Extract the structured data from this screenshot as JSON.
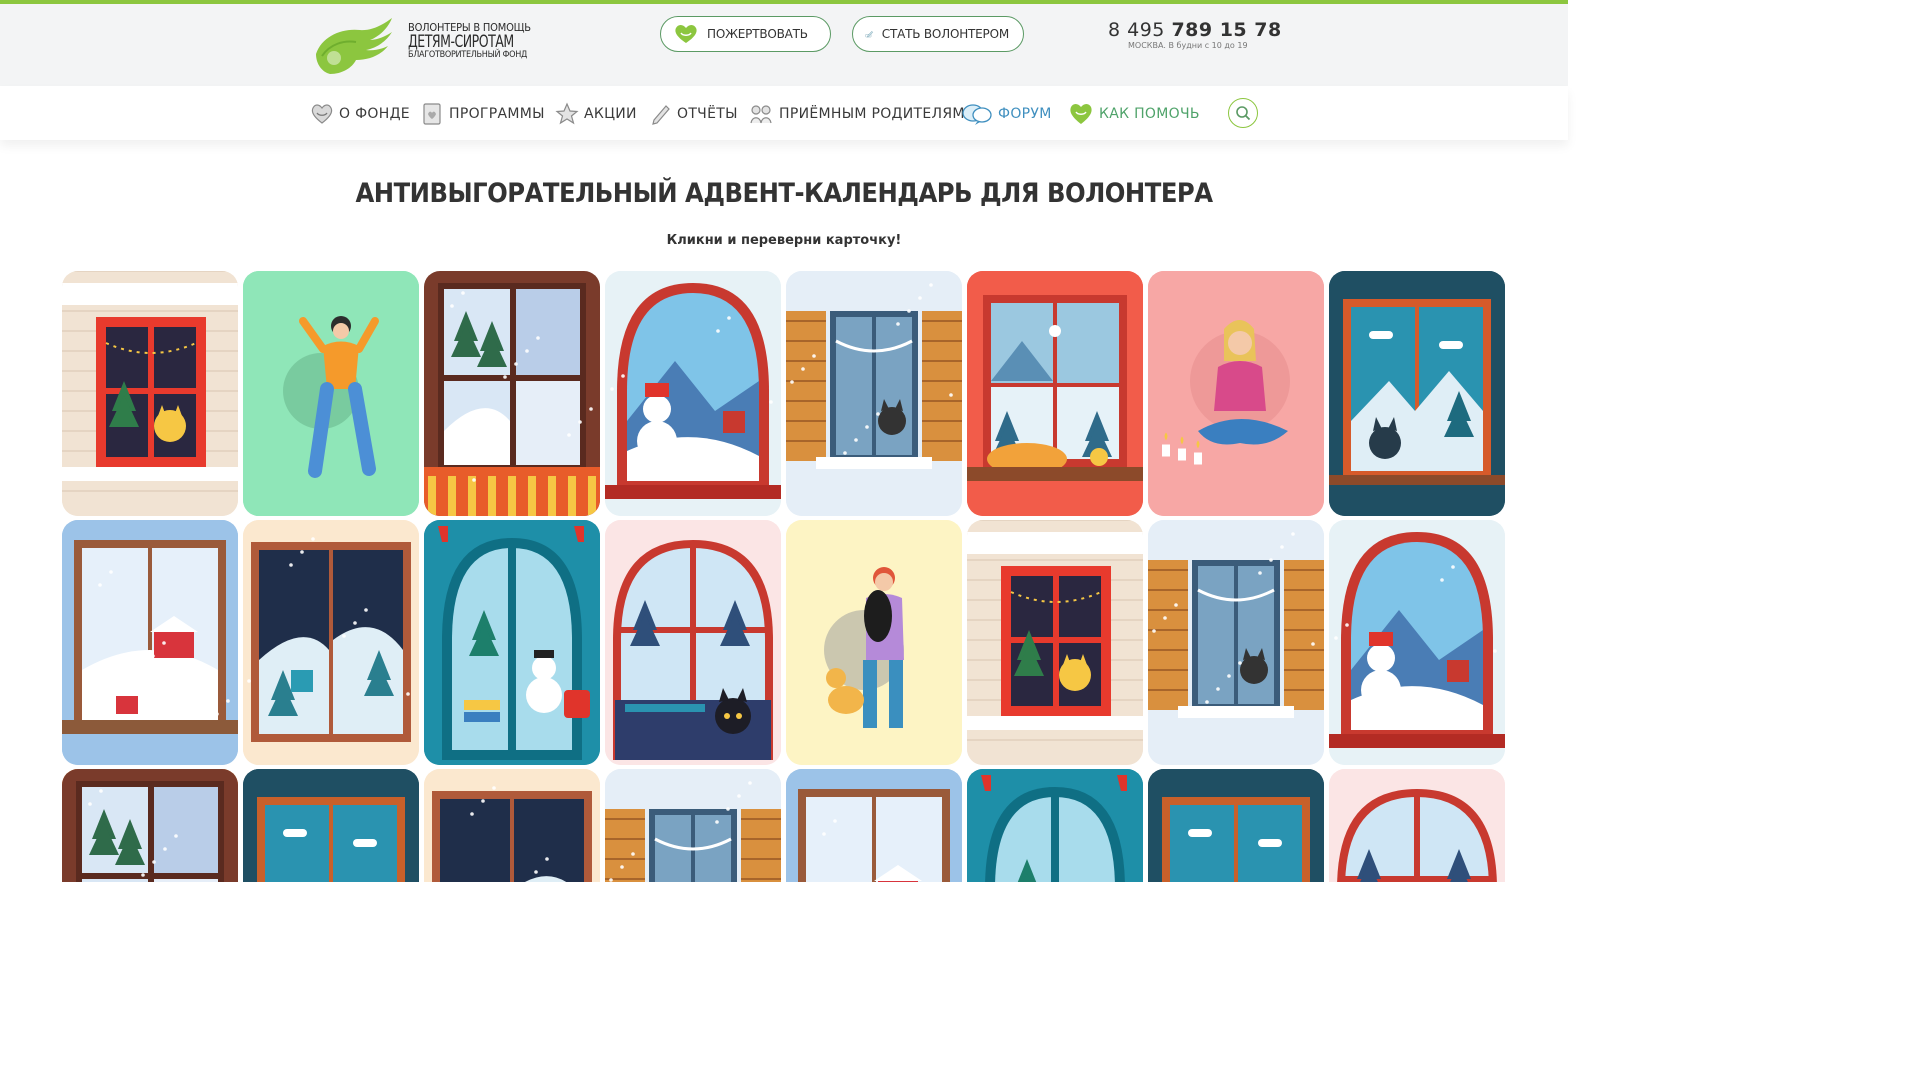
{
  "header": {
    "logo": {
      "line1": "ВОЛОНТЕРЫ В ПОМОЩЬ",
      "line2": "ДЕТЯМ-СИРОТАМ",
      "line3": "БЛАГОТВОРИТЕЛЬНЫЙ ФОНД"
    },
    "donate_label": "ПОЖЕРТВОВАТЬ",
    "volunteer_label": "СТАТЬ ВОЛОНТЕРОМ",
    "phone_prefix": "8 495 ",
    "phone_main": "789 15 78",
    "phone_note": "МОСКВА. В будни с 10 до 19"
  },
  "nav": {
    "items": [
      {
        "label": "О ФОНДЕ",
        "icon": "heart-hands-icon"
      },
      {
        "label": "ПРОГРАММЫ",
        "icon": "document-icon"
      },
      {
        "label": "АКЦИИ",
        "icon": "star-icon"
      },
      {
        "label": "ОТЧЁТЫ",
        "icon": "pencil-icon"
      },
      {
        "label": "ПРИЁМНЫМ РОДИТЕЛЯМ",
        "icon": "family-icon"
      },
      {
        "label": "ФОРУМ",
        "icon": "chat-bubbles-icon"
      },
      {
        "label": "КАК ПОМОЧЬ",
        "icon": "heart-hands-icon"
      }
    ],
    "search_icon": "search-icon"
  },
  "main": {
    "title": "АНТИВЫГОРАТЕЛЬНЫЙ АДВЕНТ-КАЛЕНДАРЬ ДЛЯ ВОЛОНТЕРА",
    "subtitle": "Кликни и переверни карточку!"
  },
  "colors": {
    "brand_green": "#8cc63f",
    "button_border": "#5b9a64",
    "forum_blue": "#3f8fbf",
    "help_green": "#4fa36a"
  },
  "cards": [
    {
      "scene": "cat-window-brick",
      "bg": "#f1e3d3"
    },
    {
      "scene": "dancing-girl",
      "bg": "#8fe6b8"
    },
    {
      "scene": "snow-window-brown",
      "bg": "#ffffff"
    },
    {
      "scene": "arch-snowman",
      "bg": "#e7f2f6"
    },
    {
      "scene": "shutters-cat",
      "bg": "#e5eef7"
    },
    {
      "scene": "red-window-cat-sleep",
      "bg": "#f25c4a"
    },
    {
      "scene": "girl-candles",
      "bg": "#f7a7a5"
    },
    {
      "scene": "teal-window-cat",
      "bg": "#1f4f63"
    },
    {
      "scene": "blue-window-house",
      "bg": "#9cc3e8"
    },
    {
      "scene": "night-window-trees",
      "bg": "#fbe8cf"
    },
    {
      "scene": "teal-arch-snowman",
      "bg": "#1e8fa8"
    },
    {
      "scene": "arch-black-cat",
      "bg": "#fbe5e5"
    },
    {
      "scene": "woman-cat-dog",
      "bg": "#fdf4c4"
    },
    {
      "scene": "cat-window-brick",
      "bg": "#f1e3d3"
    },
    {
      "scene": "shutters-cat",
      "bg": "#e5eef7"
    },
    {
      "scene": "arch-snowman",
      "bg": "#e7f2f6"
    },
    {
      "scene": "snow-window-brown",
      "bg": "#f5a35a"
    },
    {
      "scene": "teal-window",
      "bg": "#1f4f63"
    },
    {
      "scene": "night-window-trees",
      "bg": "#fbe8cf"
    },
    {
      "scene": "shutters-cat",
      "bg": "#e5eef7"
    },
    {
      "scene": "blue-window-house",
      "bg": "#9cc3e8"
    },
    {
      "scene": "teal-arch-snowman",
      "bg": "#1e8fa8"
    },
    {
      "scene": "teal-window",
      "bg": "#1f4f63"
    },
    {
      "scene": "arch-black-cat",
      "bg": "#fbe5e5"
    }
  ]
}
